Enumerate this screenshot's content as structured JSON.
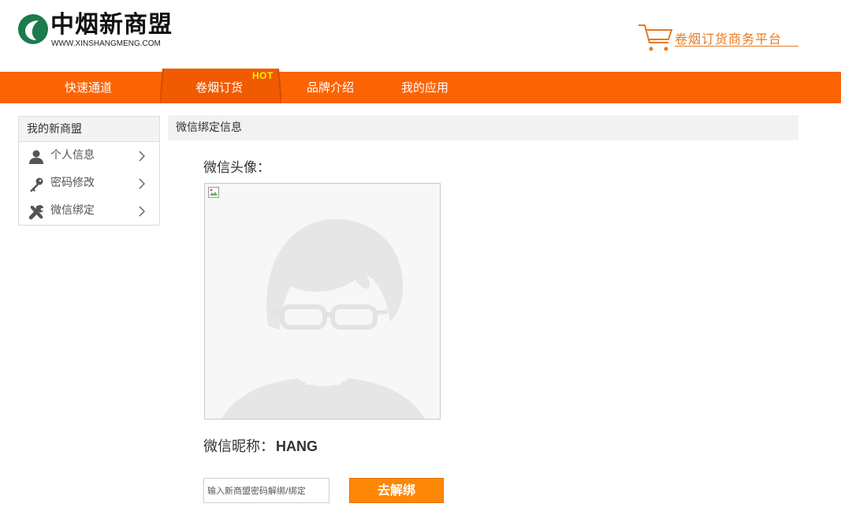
{
  "header": {
    "logo_text": "中烟新商盟",
    "logo_sub": "WWW.XINSHANGMENG.COM",
    "platform_label": "卷烟订货商务平台"
  },
  "nav": {
    "items": [
      {
        "label": "快速通道"
      },
      {
        "label": "卷烟订货"
      },
      {
        "label": "品牌介绍"
      },
      {
        "label": "我的应用"
      }
    ],
    "hot_badge": "HOT"
  },
  "sidebar": {
    "title": "我的新商盟",
    "items": [
      {
        "label": "个人信息",
        "icon": "user-icon"
      },
      {
        "label": "密码修改",
        "icon": "key-icon"
      },
      {
        "label": "微信绑定",
        "icon": "tools-icon"
      }
    ]
  },
  "main": {
    "section_title": "微信绑定信息",
    "avatar_label": "微信头像：",
    "nickname_label": "微信昵称：",
    "nickname_value": "HANG",
    "password_placeholder": "输入新商盟密码解绑/绑定",
    "unbind_button": "去解绑"
  },
  "colors": {
    "nav_bg": "#fc6302",
    "accent": "#fe8707",
    "hot": "#ffee00",
    "platform": "#e8791f"
  }
}
